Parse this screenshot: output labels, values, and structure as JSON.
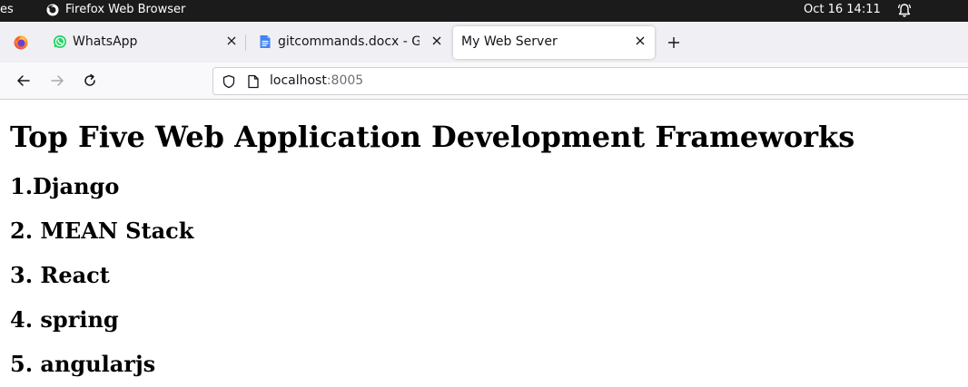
{
  "topbar": {
    "activities_label": "es",
    "app_name": "Firefox Web Browser",
    "datetime": "Oct 16  14:11",
    "icons": [
      "firefox-icon",
      "bell-icon"
    ]
  },
  "tabs": [
    {
      "label": "WhatsApp",
      "icon": "whatsapp-icon",
      "active": false
    },
    {
      "label": "gitcommands.docx - Goo",
      "icon": "google-docs-icon",
      "active": false
    },
    {
      "label": "My Web Server",
      "icon": null,
      "active": true
    }
  ],
  "navbar": {
    "url_host": "localhost",
    "url_port": ":8005"
  },
  "page": {
    "heading": "Top Five Web Application Development Frameworks",
    "items": [
      "1.Django",
      "2. MEAN Stack",
      "3. React",
      "4. spring",
      "5. angularjs"
    ]
  },
  "colors": {
    "topbar_bg": "#1b1b1b",
    "tabstrip_bg": "#f0f0f4",
    "navbar_bg": "#f9f9fb",
    "whatsapp_green": "#25d366",
    "docs_blue": "#4285f4"
  }
}
